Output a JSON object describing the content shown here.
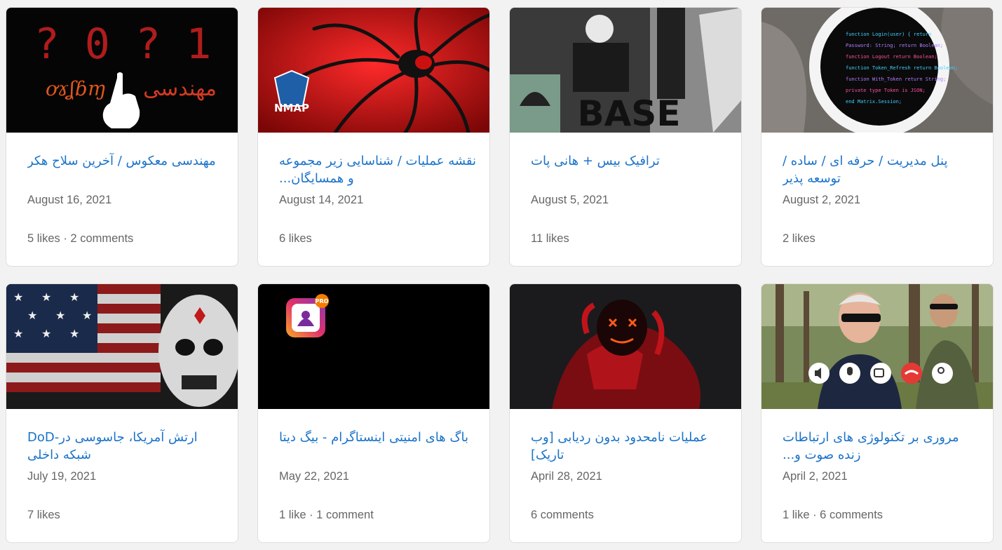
{
  "posts": [
    {
      "title": "مهندسی معکوس / آخرین سلاح هکر",
      "date": "August 16, 2021",
      "stats": "5 likes · 2 comments",
      "thumb_text": [
        "? 0 ? 1",
        "مهندسی"
      ]
    },
    {
      "title": "نقشه عملیات / شناسایی زیر مجموعه و همسایگان...",
      "date": "August 14, 2021",
      "stats": "6 likes",
      "thumb_text": [
        "NMAP"
      ]
    },
    {
      "title": "ترافیک بیس + هانی پات",
      "date": "August 5, 2021",
      "stats": "11 likes",
      "thumb_text": [
        "BASE"
      ]
    },
    {
      "title": "پنل مدیریت / حرفه ای / ساده / توسعه پذیر",
      "date": "August 2, 2021",
      "stats": "2 likes",
      "thumb_text": []
    },
    {
      "title": "ارتش آمریکا، جاسوسی در-DoD شبکه داخلی",
      "date": "July 19, 2021",
      "stats": "7 likes",
      "thumb_text": []
    },
    {
      "title": "باگ های امنیتی اینستاگرام - بیگ دیتا",
      "date": "May 22, 2021",
      "stats": "1 like · 1 comment",
      "thumb_text": [
        "PRO"
      ]
    },
    {
      "title": "عملیات نامحدود بدون ردیابی [وب تاریک]",
      "date": "April 28, 2021",
      "stats": "6 comments",
      "thumb_text": []
    },
    {
      "title": "مروری بر تکنولوژی های ارتباطات زنده صوت و...",
      "date": "April 2, 2021",
      "stats": "1 like · 6 comments",
      "thumb_text": []
    }
  ],
  "colors": {
    "title": "#1a73c9",
    "meta": "#666666",
    "card_bg": "#ffffff",
    "page_bg": "#f2f2f2"
  }
}
